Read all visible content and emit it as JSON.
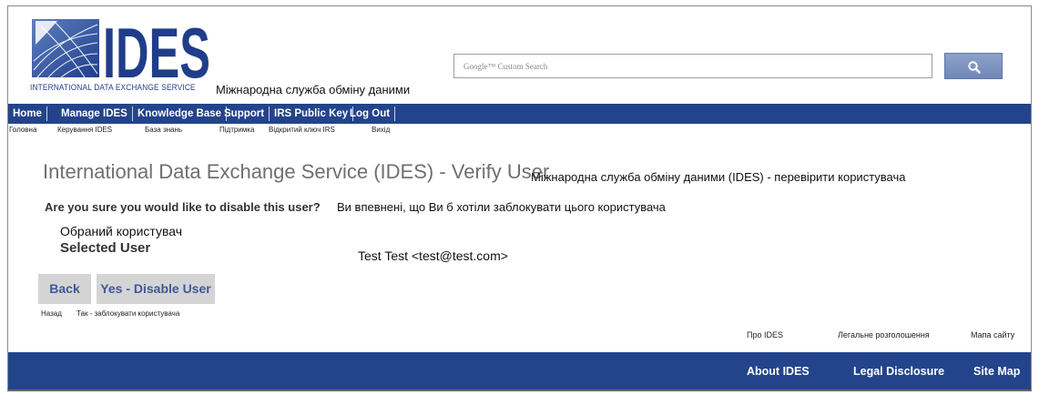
{
  "header": {
    "logo_text": "IDES",
    "logo_tagline": "INTERNATIONAL DATA EXCHANGE SERVICE",
    "logo_translation": "Міжнародна служба обміну даними",
    "search_placeholder": "Google™ Custom Search",
    "search_button_icon": "search-icon"
  },
  "nav": {
    "items": [
      {
        "label": "Home",
        "translation": "Головна"
      },
      {
        "label": "Manage IDES",
        "translation": "Керування IDES"
      },
      {
        "label": "Knowledge Base",
        "translation": "База знань"
      },
      {
        "label": "Support",
        "translation": "Підтримка"
      },
      {
        "label": "IRS Public Key",
        "translation": "Відкритий ключ IRS"
      },
      {
        "label": "Log Out",
        "translation": "Вихід"
      }
    ]
  },
  "main": {
    "title": "International Data Exchange Service (IDES) - Verify User",
    "title_translation": "Міжнародна служба обміну даними (IDES) - перевірити користувача",
    "question": "Are you sure you would like to disable this user?",
    "question_translation": "Ви впевнені, що Ви б хотіли заблокувати цього користувача",
    "selected_label_translation": "Обраний користувач",
    "selected_label": "Selected User",
    "selected_value": "Test Test <test@test.com>",
    "buttons": {
      "back": "Back",
      "back_translation": "Назад",
      "yes": "Yes - Disable User",
      "yes_translation": "Так - заблокувати користувача"
    }
  },
  "footer": {
    "links": [
      {
        "label": "About IDES",
        "translation": "Про IDES"
      },
      {
        "label": "Legal Disclosure",
        "translation": "Легальне розголошення"
      },
      {
        "label": "Site Map",
        "translation": "Мапа сайту"
      }
    ]
  },
  "colors": {
    "nav_bar": "#23448a",
    "button_bg": "#d4d4d4",
    "button_text": "#40579a",
    "title_text": "#6f6f6f"
  }
}
